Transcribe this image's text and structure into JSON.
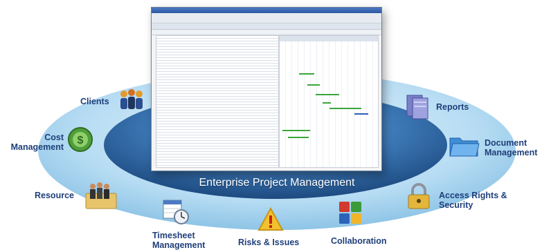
{
  "center_title": "Enterprise Project Management",
  "nodes": [
    {
      "label": "Clients",
      "icon": "people-icon"
    },
    {
      "label": "Cost\nManagement",
      "icon": "dollar-cycle-icon"
    },
    {
      "label": "Resource",
      "icon": "team-folder-icon"
    },
    {
      "label": "Timesheet\nManagement",
      "icon": "calendar-clock-icon"
    },
    {
      "label": "Risks & Issues",
      "icon": "warning-icon"
    },
    {
      "label": "Collaboration",
      "icon": "puzzle-icon"
    },
    {
      "label": "Access Rights &\nSecurity",
      "icon": "padlock-icon"
    },
    {
      "label": "Document\nManagement",
      "icon": "folder-icon"
    },
    {
      "label": "Reports",
      "icon": "binders-icon"
    }
  ],
  "colors": {
    "ring_outer": "#a9d3ee",
    "ring_inner": "#2d5f96",
    "label": "#1f3f7a",
    "gantt_bar": "#3aa63a",
    "gantt_milestone": "#2b5fb8"
  },
  "screenshot_icon": "project-app-screenshot"
}
